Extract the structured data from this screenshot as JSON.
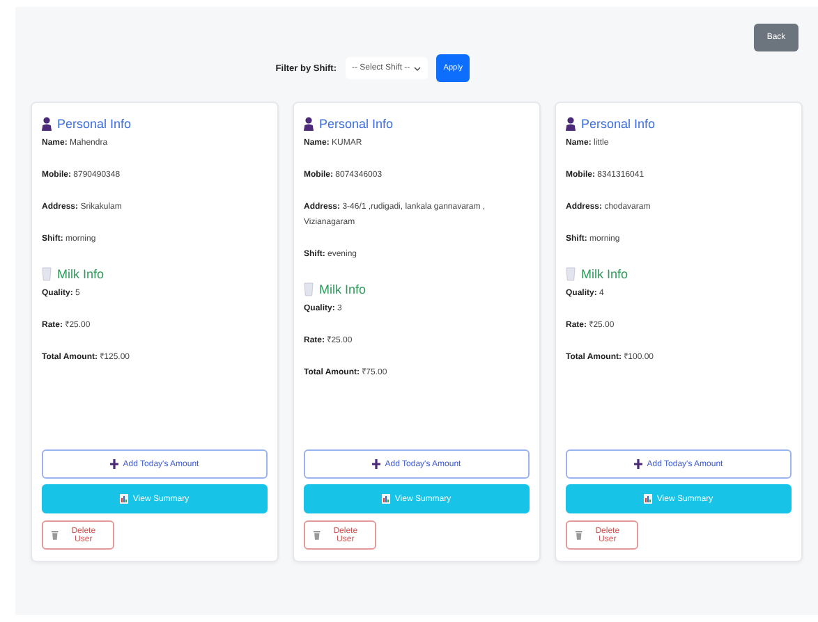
{
  "back_button": "Back",
  "filter": {
    "label": "Filter by Shift:",
    "placeholder": "-- Select Shift --",
    "apply": "Apply"
  },
  "cards": [
    {
      "personal_title": "Personal Info",
      "personal": [
        {
          "label": "Name:",
          "value": "Mahendra"
        },
        {
          "label": "Mobile:",
          "value": "8790490348"
        },
        {
          "label": "Address:",
          "value": "Srikakulam"
        },
        {
          "label": "Shift:",
          "value": "morning"
        }
      ],
      "milk_title": "Milk Info",
      "milk": [
        {
          "label": "Quality:",
          "value": "5"
        },
        {
          "label": "Rate:",
          "value": "₹25.00"
        },
        {
          "label": "Total Amount:",
          "value": "₹125.00"
        }
      ],
      "buttons": {
        "add": "Add Today's Amount",
        "summary": "View Summary",
        "delete": "Delete User"
      }
    },
    {
      "personal_title": "Personal Info",
      "personal": [
        {
          "label": "Name:",
          "value": "KUMAR"
        },
        {
          "label": "Mobile:",
          "value": "8074346003"
        },
        {
          "label": "Address:",
          "value": "3-46/1 ,rudigadi, lankala gannavaram , Vizianagaram"
        },
        {
          "label": "Shift:",
          "value": "evening"
        }
      ],
      "milk_title": "Milk Info",
      "milk": [
        {
          "label": "Quality:",
          "value": "3"
        },
        {
          "label": "Rate:",
          "value": "₹25.00"
        },
        {
          "label": "Total Amount:",
          "value": "₹75.00"
        }
      ],
      "buttons": {
        "add": "Add Today's Amount",
        "summary": "View Summary",
        "delete": "Delete User"
      }
    },
    {
      "personal_title": "Personal Info",
      "personal": [
        {
          "label": "Name:",
          "value": "little"
        },
        {
          "label": "Mobile:",
          "value": "8341316041"
        },
        {
          "label": "Address:",
          "value": "chodavaram"
        },
        {
          "label": "Shift:",
          "value": "morning"
        }
      ],
      "milk_title": "Milk Info",
      "milk": [
        {
          "label": "Quality:",
          "value": "4"
        },
        {
          "label": "Rate:",
          "value": "₹25.00"
        },
        {
          "label": "Total Amount:",
          "value": "₹100.00"
        }
      ],
      "buttons": {
        "add": "Add Today's Amount",
        "summary": "View Summary",
        "delete": "Delete User"
      }
    }
  ]
}
